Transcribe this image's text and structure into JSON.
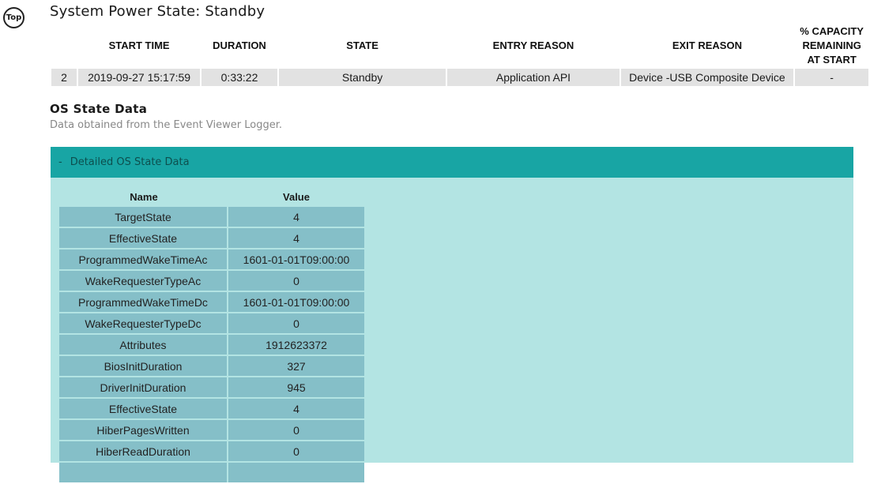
{
  "nav": {
    "top_label": "Top"
  },
  "title": "System Power State: Standby",
  "state_table": {
    "headers": [
      "START TIME",
      "DURATION",
      "STATE",
      "ENTRY REASON",
      "EXIT REASON",
      "% CAPACITY REMAINING AT START"
    ],
    "row": {
      "index": "2",
      "start_time": "2019-09-27  15:17:59",
      "duration": "0:33:22",
      "state": "Standby",
      "entry_reason": "Application API",
      "exit_reason": "Device -USB Composite Device",
      "capacity": "-"
    }
  },
  "os_section": {
    "title": "OS State Data",
    "subtitle": "Data obtained from the Event Viewer Logger."
  },
  "panel": {
    "toggle": "-",
    "label": "Detailed OS State Data",
    "columns": [
      "Name",
      "Value"
    ],
    "rows": [
      [
        "TargetState",
        "4"
      ],
      [
        "EffectiveState",
        "4"
      ],
      [
        "ProgrammedWakeTimeAc",
        "1601-01-01T09:00:00"
      ],
      [
        "WakeRequesterTypeAc",
        "0"
      ],
      [
        "ProgrammedWakeTimeDc",
        "1601-01-01T09:00:00"
      ],
      [
        "WakeRequesterTypeDc",
        "0"
      ],
      [
        "Attributes",
        "1912623372"
      ],
      [
        "BiosInitDuration",
        "327"
      ],
      [
        "DriverInitDuration",
        "945"
      ],
      [
        "EffectiveState",
        "4"
      ],
      [
        "HiberPagesWritten",
        "0"
      ],
      [
        "HiberReadDuration",
        "0"
      ],
      [
        "",
        ""
      ]
    ]
  }
}
